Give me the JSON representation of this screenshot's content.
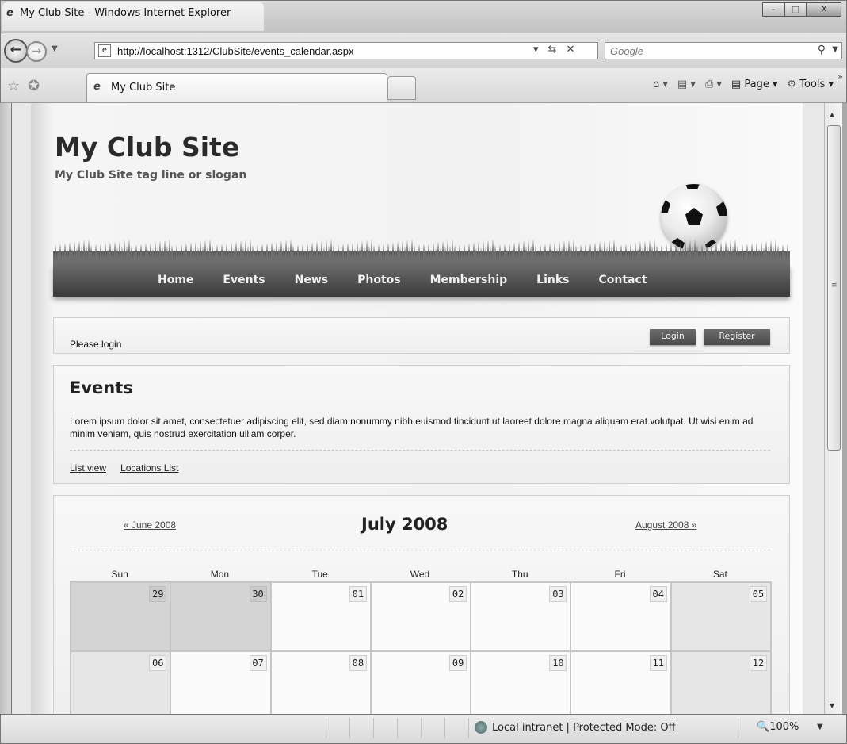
{
  "window": {
    "title": "My Club Site - Windows Internet Explorer",
    "buttons": {
      "minimize": "–",
      "maximize": "□",
      "close": "X"
    }
  },
  "address": {
    "url": "http://localhost:1312/ClubSite/events_calendar.aspx",
    "search_placeholder": "Google"
  },
  "tabs": [
    {
      "label": "My Club Site",
      "active": true
    }
  ],
  "commands": {
    "page_label": "Page",
    "tools_label": "Tools"
  },
  "site": {
    "title": "My Club Site",
    "tagline": "My Club Site tag line or slogan",
    "nav": [
      "Home",
      "Events",
      "News",
      "Photos",
      "Membership",
      "Links",
      "Contact"
    ]
  },
  "login": {
    "prompt": "Please login",
    "login_label": "Login",
    "register_label": "Register"
  },
  "events": {
    "heading": "Events",
    "body": "Lorem ipsum dolor sit amet, consectetuer adipiscing elit, sed diam nonummy nibh euismod tincidunt ut laoreet dolore magna aliquam erat volutpat. Ut wisi enim ad minim veniam, quis nostrud exercitation ulliam corper.",
    "links": [
      "List view",
      "Locations List"
    ]
  },
  "calendar": {
    "prev_label": "« June 2008",
    "month_label": "July 2008",
    "next_label": "August 2008 »",
    "days_of_week": [
      "Sun",
      "Mon",
      "Tue",
      "Wed",
      "Thu",
      "Fri",
      "Sat"
    ],
    "weeks": [
      [
        {
          "day": "29",
          "current": false
        },
        {
          "day": "30",
          "current": false
        },
        {
          "day": "01",
          "current": true
        },
        {
          "day": "02",
          "current": true
        },
        {
          "day": "03",
          "current": true
        },
        {
          "day": "04",
          "current": true
        },
        {
          "day": "05",
          "current": true
        }
      ],
      [
        {
          "day": "06",
          "current": true
        },
        {
          "day": "07",
          "current": true
        },
        {
          "day": "08",
          "current": true
        },
        {
          "day": "09",
          "current": true
        },
        {
          "day": "10",
          "current": true
        },
        {
          "day": "11",
          "current": true
        },
        {
          "day": "12",
          "current": true
        }
      ]
    ]
  },
  "status": {
    "zone": "Local intranet | Protected Mode: Off",
    "zoom": "100%"
  }
}
